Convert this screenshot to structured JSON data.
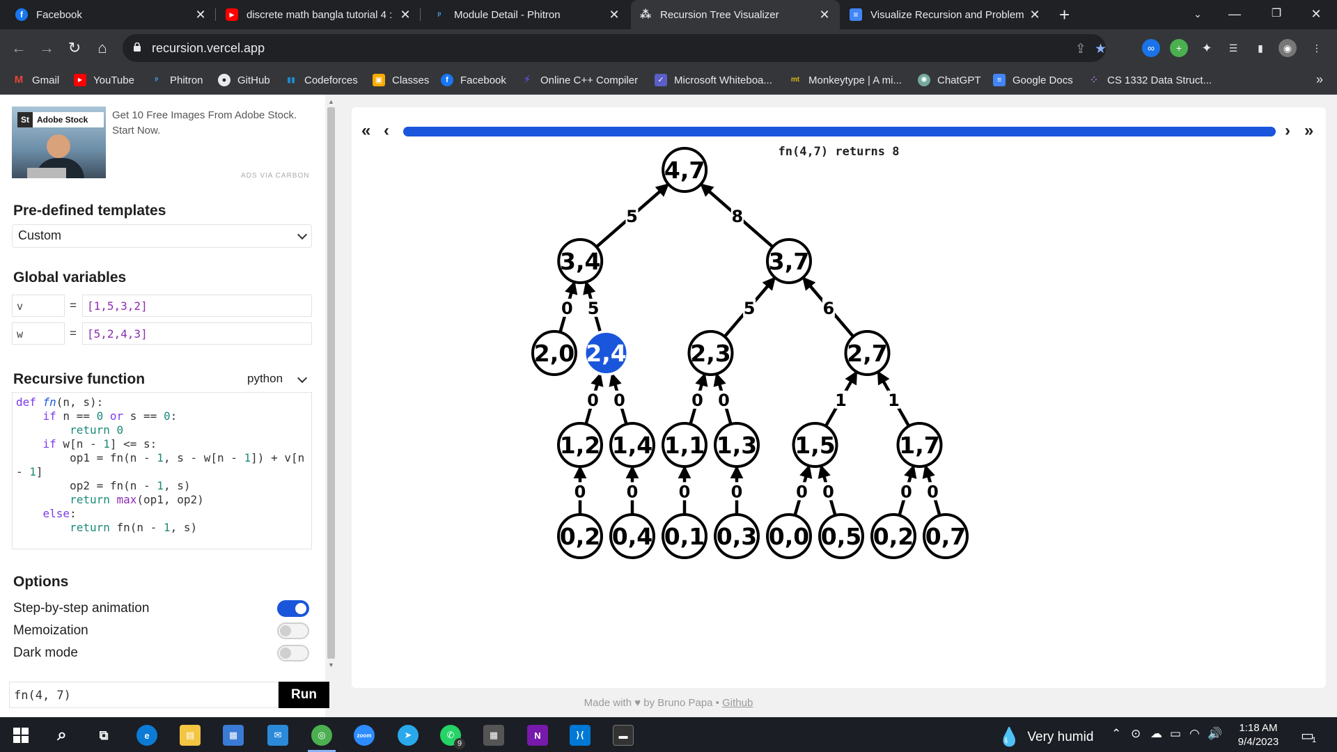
{
  "browser": {
    "tabs": [
      {
        "title": "Facebook",
        "favicon": "facebook-icon",
        "color": "#1877f2",
        "glyph": "f"
      },
      {
        "title": "discrete math bangla tutorial 4 : ",
        "favicon": "youtube-icon",
        "color": "#ff0000",
        "glyph": "▶"
      },
      {
        "title": "Module Detail - Phitron",
        "favicon": "phitron-icon",
        "color": "#35363a",
        "glyph": "ᵖ"
      },
      {
        "title": "Recursion Tree Visualizer",
        "favicon": "recursion-tree-icon",
        "color": "#35363a",
        "glyph": "⁂"
      },
      {
        "title": "Visualize Recursion and Problem",
        "favicon": "google-docs-icon",
        "color": "#4285f4",
        "glyph": "≡"
      }
    ],
    "url": "recursion.vercel.app",
    "bookmarks": [
      {
        "label": "Gmail",
        "icon": "gmail-icon",
        "color": "#ea4335",
        "glyph": "M"
      },
      {
        "label": "YouTube",
        "icon": "youtube-icon",
        "color": "#ff0000",
        "glyph": "▶"
      },
      {
        "label": "Phitron",
        "icon": "phitron-icon",
        "color": "#35363a",
        "glyph": "ᵖ"
      },
      {
        "label": "GitHub",
        "icon": "github-icon",
        "color": "#e8eaed",
        "glyph": "●"
      },
      {
        "label": "Codeforces",
        "icon": "codeforces-icon",
        "color": "#1f8acb",
        "glyph": "▮"
      },
      {
        "label": "Classes",
        "icon": "google-classroom-icon",
        "color": "#f9ab00",
        "glyph": "▣"
      },
      {
        "label": "Facebook",
        "icon": "facebook-icon",
        "color": "#1877f2",
        "glyph": "f"
      },
      {
        "label": "Online C++ Compiler",
        "icon": "compiler-icon",
        "color": "#7c4dff",
        "glyph": "⚡"
      },
      {
        "label": "Microsoft Whiteboa...",
        "icon": "whiteboard-icon",
        "color": "#5b5fc7",
        "glyph": "✓"
      },
      {
        "label": "Monkeytype | A mi...",
        "icon": "monkeytype-icon",
        "color": "#e2b714",
        "glyph": "mt"
      },
      {
        "label": "ChatGPT",
        "icon": "chatgpt-icon",
        "color": "#74aa9c",
        "glyph": "✺"
      },
      {
        "label": "Google Docs",
        "icon": "google-docs-icon",
        "color": "#4285f4",
        "glyph": "≡"
      },
      {
        "label": "CS 1332 Data Struct...",
        "icon": "cs1332-icon",
        "color": "#35363a",
        "glyph": "⁘"
      }
    ]
  },
  "ad": {
    "logo": "Adobe Stock",
    "logo_short": "St",
    "text": "Get 10 Free Images From Adobe Stock. Start Now.",
    "via": "ADS VIA CARBON"
  },
  "templates": {
    "title": "Pre-defined templates",
    "selected": "Custom"
  },
  "globals": {
    "title": "Global variables",
    "vars": [
      {
        "name": "v",
        "value": "[1,5,3,2]"
      },
      {
        "name": "w",
        "value": "[5,2,4,3]"
      }
    ]
  },
  "function": {
    "title": "Recursive function",
    "language": "python",
    "code_lines": [
      [
        {
          "t": "def ",
          "c": "kw"
        },
        {
          "t": "fn",
          "c": "fn"
        },
        {
          "t": "(n, s):",
          "c": ""
        }
      ],
      [
        {
          "t": "    ",
          "c": ""
        },
        {
          "t": "if",
          "c": "kw"
        },
        {
          "t": " n == ",
          "c": ""
        },
        {
          "t": "0",
          "c": "num"
        },
        {
          "t": " ",
          "c": ""
        },
        {
          "t": "or",
          "c": "kw"
        },
        {
          "t": " s == ",
          "c": ""
        },
        {
          "t": "0",
          "c": "num"
        },
        {
          "t": ":",
          "c": ""
        }
      ],
      [
        {
          "t": "        ",
          "c": ""
        },
        {
          "t": "return",
          "c": "kw2"
        },
        {
          "t": " ",
          "c": ""
        },
        {
          "t": "0",
          "c": "num"
        }
      ],
      [
        {
          "t": "    ",
          "c": ""
        },
        {
          "t": "if",
          "c": "kw"
        },
        {
          "t": " w[n - ",
          "c": ""
        },
        {
          "t": "1",
          "c": "num"
        },
        {
          "t": "] <= s:",
          "c": ""
        }
      ],
      [
        {
          "t": "        op1 = fn(n - ",
          "c": ""
        },
        {
          "t": "1",
          "c": "num"
        },
        {
          "t": ", s - w[n - ",
          "c": ""
        },
        {
          "t": "1",
          "c": "num"
        },
        {
          "t": "]) + v[n",
          "c": ""
        }
      ],
      [
        {
          "t": "- ",
          "c": ""
        },
        {
          "t": "1",
          "c": "num"
        },
        {
          "t": "]",
          "c": ""
        }
      ],
      [
        {
          "t": "        op2 = fn(n - ",
          "c": ""
        },
        {
          "t": "1",
          "c": "num"
        },
        {
          "t": ", s)",
          "c": ""
        }
      ],
      [
        {
          "t": "        ",
          "c": ""
        },
        {
          "t": "return",
          "c": "kw2"
        },
        {
          "t": " ",
          "c": ""
        },
        {
          "t": "max",
          "c": "builtin"
        },
        {
          "t": "(op1, op2)",
          "c": ""
        }
      ],
      [
        {
          "t": "    ",
          "c": ""
        },
        {
          "t": "else",
          "c": "kw"
        },
        {
          "t": ":",
          "c": ""
        }
      ],
      [
        {
          "t": "        ",
          "c": ""
        },
        {
          "t": "return",
          "c": "kw2"
        },
        {
          "t": " fn(n - ",
          "c": ""
        },
        {
          "t": "1",
          "c": "num"
        },
        {
          "t": ", s)",
          "c": ""
        }
      ]
    ]
  },
  "options": {
    "title": "Options",
    "items": [
      {
        "label": "Step-by-step animation",
        "on": true
      },
      {
        "label": "Memoization",
        "on": false
      },
      {
        "label": "Dark mode",
        "on": false
      }
    ]
  },
  "call": {
    "value": "fn(4, 7)",
    "run_label": "Run"
  },
  "visualizer": {
    "return_text": "fn(4,7) returns 8",
    "progress": 1.0,
    "highlight_color": "#1a56db",
    "nodes": [
      {
        "id": "n47",
        "label": "4,7",
        "parent": null,
        "edge": null,
        "highlight": false
      },
      {
        "id": "n34",
        "label": "3,4",
        "parent": "n47",
        "edge": "5",
        "highlight": false
      },
      {
        "id": "n37",
        "label": "3,7",
        "parent": "n47",
        "edge": "8",
        "highlight": false
      },
      {
        "id": "n20",
        "label": "2,0",
        "parent": "n34",
        "edge": "0",
        "highlight": false
      },
      {
        "id": "n24",
        "label": "2,4",
        "parent": "n34",
        "edge": "5",
        "highlight": true
      },
      {
        "id": "n23",
        "label": "2,3",
        "parent": "n37",
        "edge": "5",
        "highlight": false
      },
      {
        "id": "n27",
        "label": "2,7",
        "parent": "n37",
        "edge": "6",
        "highlight": false
      },
      {
        "id": "n12",
        "label": "1,2",
        "parent": "n24",
        "edge": "0",
        "highlight": false
      },
      {
        "id": "n14",
        "label": "1,4",
        "parent": "n24",
        "edge": "0",
        "highlight": false
      },
      {
        "id": "n11",
        "label": "1,1",
        "parent": "n23",
        "edge": "0",
        "highlight": false
      },
      {
        "id": "n13",
        "label": "1,3",
        "parent": "n23",
        "edge": "0",
        "highlight": false
      },
      {
        "id": "n15",
        "label": "1,5",
        "parent": "n27",
        "edge": "1",
        "highlight": false
      },
      {
        "id": "n17",
        "label": "1,7",
        "parent": "n27",
        "edge": "1",
        "highlight": false
      },
      {
        "id": "a02",
        "label": "0,2",
        "parent": "n12",
        "edge": "0",
        "highlight": false
      },
      {
        "id": "a04",
        "label": "0,4",
        "parent": "n14",
        "edge": "0",
        "highlight": false
      },
      {
        "id": "a01",
        "label": "0,1",
        "parent": "n11",
        "edge": "0",
        "highlight": false
      },
      {
        "id": "a03",
        "label": "0,3",
        "parent": "n13",
        "edge": "0",
        "highlight": false
      },
      {
        "id": "a00",
        "label": "0,0",
        "parent": "n15",
        "edge": "0",
        "highlight": false
      },
      {
        "id": "a05",
        "label": "0,5",
        "parent": "n15",
        "edge": "0",
        "highlight": false
      },
      {
        "id": "b02",
        "label": "0,2",
        "parent": "n17",
        "edge": "0",
        "highlight": false
      },
      {
        "id": "a07",
        "label": "0,7",
        "parent": "n17",
        "edge": "0",
        "highlight": false
      }
    ]
  },
  "footer": {
    "made_with": "Made with ♥ by Bruno Papa • ",
    "github": "Github"
  },
  "taskbar": {
    "weather": "Very humid",
    "whatsapp_badge": "9",
    "time": "1:18 AM",
    "date": "9/4/2023",
    "notification_count": "1"
  }
}
